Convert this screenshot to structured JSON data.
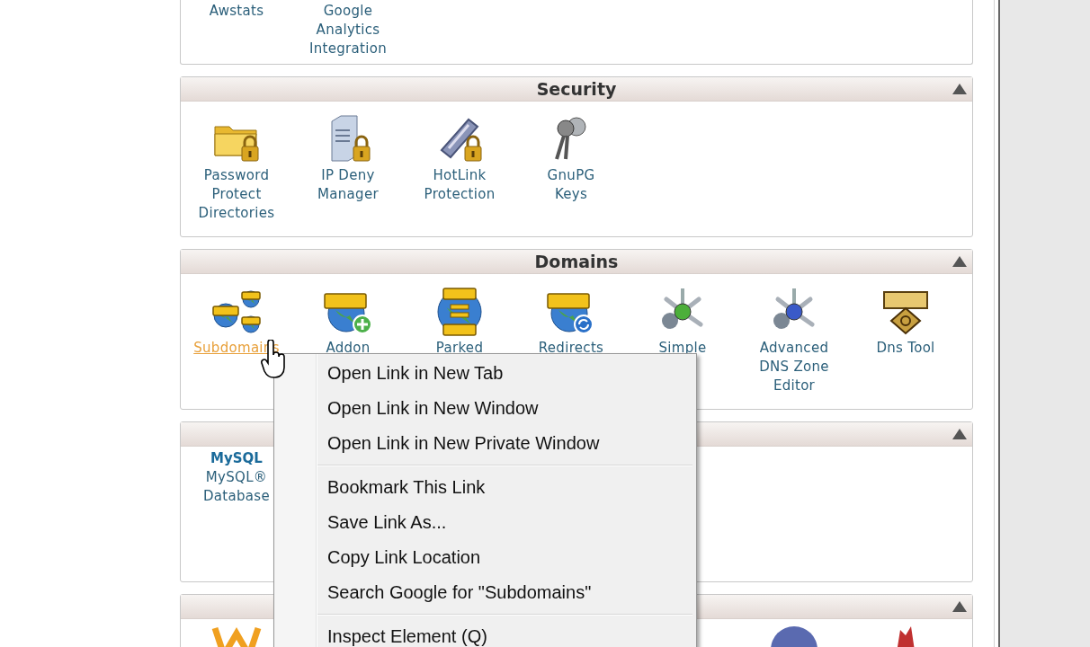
{
  "top_section": {
    "items": [
      {
        "label": "Awstats",
        "hovered": false
      },
      {
        "label": "Google\nAnalytics\nIntegration",
        "hovered": false
      }
    ]
  },
  "sections": [
    {
      "title": "Security",
      "items": [
        {
          "kind": "folder-lock",
          "label": "Password\nProtect\nDirectories",
          "hovered": false
        },
        {
          "kind": "server-lock",
          "label": "IP Deny\nManager",
          "hovered": false
        },
        {
          "kind": "chain-lock",
          "label": "HotLink\nProtection",
          "hovered": false
        },
        {
          "kind": "keys",
          "label": "GnuPG\nKeys",
          "hovered": false
        }
      ]
    },
    {
      "title": "Domains",
      "items": [
        {
          "kind": "globes",
          "label": "Subdomains",
          "hovered": true
        },
        {
          "kind": "globe-plus",
          "label": "Addon",
          "hovered": false
        },
        {
          "kind": "globe-equals",
          "label": "Parked",
          "hovered": false
        },
        {
          "kind": "globe-arrows",
          "label": "Redirects",
          "hovered": false
        },
        {
          "kind": "zone-green",
          "label": "Simple",
          "hovered": false
        },
        {
          "kind": "zone-blue",
          "label": "Advanced\nDNS Zone\nEditor",
          "hovered": false
        },
        {
          "kind": "dns-badge",
          "label": "Dns Tool",
          "hovered": false
        }
      ]
    },
    {
      "items": [
        {
          "kind": "mysql",
          "logo_text": "MySQL",
          "label": "MySQL®\nDatabase",
          "hovered": false
        }
      ]
    },
    {
      "items": [
        {
          "kind": "orange-logo",
          "hovered": false
        },
        {
          "kind": "blue-ball",
          "hovered": false
        },
        {
          "kind": "red-figure",
          "hovered": false
        }
      ]
    }
  ],
  "context_menu": [
    {
      "kind": "item",
      "label": "Open Link in New Tab"
    },
    {
      "kind": "item",
      "label": "Open Link in New Window"
    },
    {
      "kind": "item",
      "label": "Open Link in New Private Window"
    },
    {
      "kind": "separator"
    },
    {
      "kind": "item",
      "label": "Bookmark This Link"
    },
    {
      "kind": "item",
      "label": "Save Link As..."
    },
    {
      "kind": "item",
      "label": "Copy Link Location"
    },
    {
      "kind": "item",
      "label": "Search Google for \"Subdomains\""
    },
    {
      "kind": "separator"
    },
    {
      "kind": "item",
      "label": "Inspect Element (Q)"
    }
  ]
}
